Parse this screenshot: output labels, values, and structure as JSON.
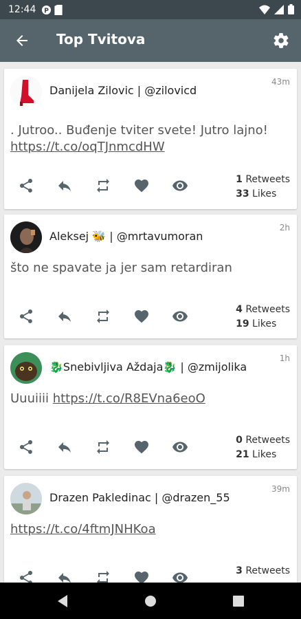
{
  "status_bar": {
    "time": "12:44"
  },
  "header": {
    "title": "Top Tvitova"
  },
  "tweets": [
    {
      "author": "Danijela Zilovic | @zilovicd",
      "time": "43m",
      "text": ". Jutroo.. Buđenje tviter svete! Jutro lajno!",
      "link": "https://t.co/oqTJnmcdHW",
      "retweets": "1",
      "retweets_label": " Retweets",
      "likes": "33",
      "likes_label": " Likes",
      "avatar": "red-boot-avatar"
    },
    {
      "author": "Aleksej 🐝 | @mrtavumoran",
      "time": "2h",
      "text": "što ne spavate ja jer sam retardiran",
      "link": "",
      "retweets": "4",
      "retweets_label": " Retweets",
      "likes": "19",
      "likes_label": " Likes",
      "avatar": "dark-portrait-avatar"
    },
    {
      "author": "🐉Snebivljiva Aždaja🐉 | @zmijolika",
      "time": "1h",
      "text": "Uuuiiii ",
      "link": "https://t.co/R8EVna6eoO",
      "retweets": "0",
      "retweets_label": " Retweets",
      "likes": "21",
      "likes_label": " Likes",
      "avatar": "cartoon-creature-avatar"
    },
    {
      "author": "Drazen Pakledinac | @drazen_55",
      "time": "39m",
      "text": "",
      "link": "https://t.co/4ftmJNHKoa",
      "retweets": "3",
      "retweets_label": " Retweets",
      "likes": "",
      "likes_label": "",
      "avatar": "person-photo-avatar"
    }
  ],
  "colors": {
    "status_bar": "#3d474e",
    "app_bar": "#56646c",
    "icon": "#56646c",
    "background": "#ebebeb"
  }
}
